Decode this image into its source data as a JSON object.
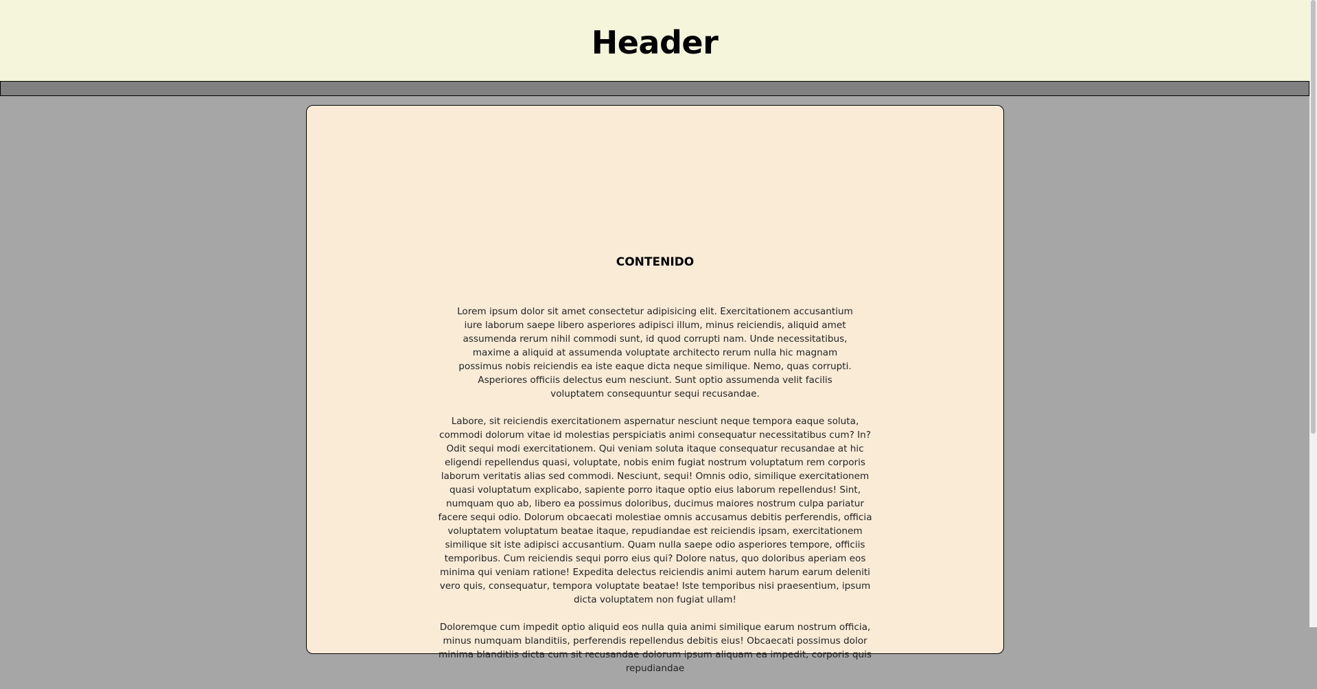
{
  "header": {
    "title": "Header"
  },
  "main": {
    "title": "CONTENIDO",
    "paragraphs": [
      "Lorem ipsum dolor sit amet consectetur adipisicing elit. Exercitationem accusantium iure laborum saepe libero asperiores adipisci illum, minus reiciendis, aliquid amet assumenda rerum nihil commodi sunt, id quod corrupti nam. Unde necessitatibus, maxime a aliquid at assumenda voluptate architecto rerum nulla hic magnam possimus nobis reiciendis ea iste eaque dicta neque similique. Nemo, quas corrupti. Asperiores officiis delectus eum nesciunt. Sunt optio assumenda velit facilis voluptatem consequuntur sequi recusandae.",
      "Labore, sit reiciendis exercitationem aspernatur nesciunt neque tempora eaque soluta, commodi dolorum vitae id molestias perspiciatis animi consequatur necessitatibus cum? In? Odit sequi modi exercitationem. Qui veniam soluta itaque consequatur recusandae at hic eligendi repellendus quasi, voluptate, nobis enim fugiat nostrum voluptatum rem corporis laborum veritatis alias sed commodi. Nesciunt, sequi! Omnis odio, similique exercitationem quasi voluptatum explicabo, sapiente porro itaque optio eius laborum repellendus! Sint, numquam quo ab, libero ea possimus doloribus, ducimus maiores nostrum culpa pariatur facere sequi odio. Dolorum obcaecati molestiae omnis accusamus debitis perferendis, officia voluptatem voluptatum beatae itaque, repudiandae est reiciendis ipsam, exercitationem similique sit iste adipisci accusantium. Quam nulla saepe odio asperiores tempore, officiis temporibus. Cum reiciendis sequi porro eius qui? Dolore natus, quo doloribus aperiam eos minima qui veniam ratione! Expedita delectus reiciendis animi autem harum earum deleniti vero quis, consequatur, tempora voluptate beatae! Iste temporibus nisi praesentium, ipsum dicta voluptatem non fugiat ullam!",
      "Doloremque cum impedit optio aliquid eos nulla quia animi similique earum nostrum officia, minus numquam blanditiis, perferendis repellendus debitis eius! Obcaecati possimus dolor minima blanditiis dicta cum sit recusandae dolorum ipsum aliquam ea impedit, corporis quis repudiandae"
    ]
  }
}
